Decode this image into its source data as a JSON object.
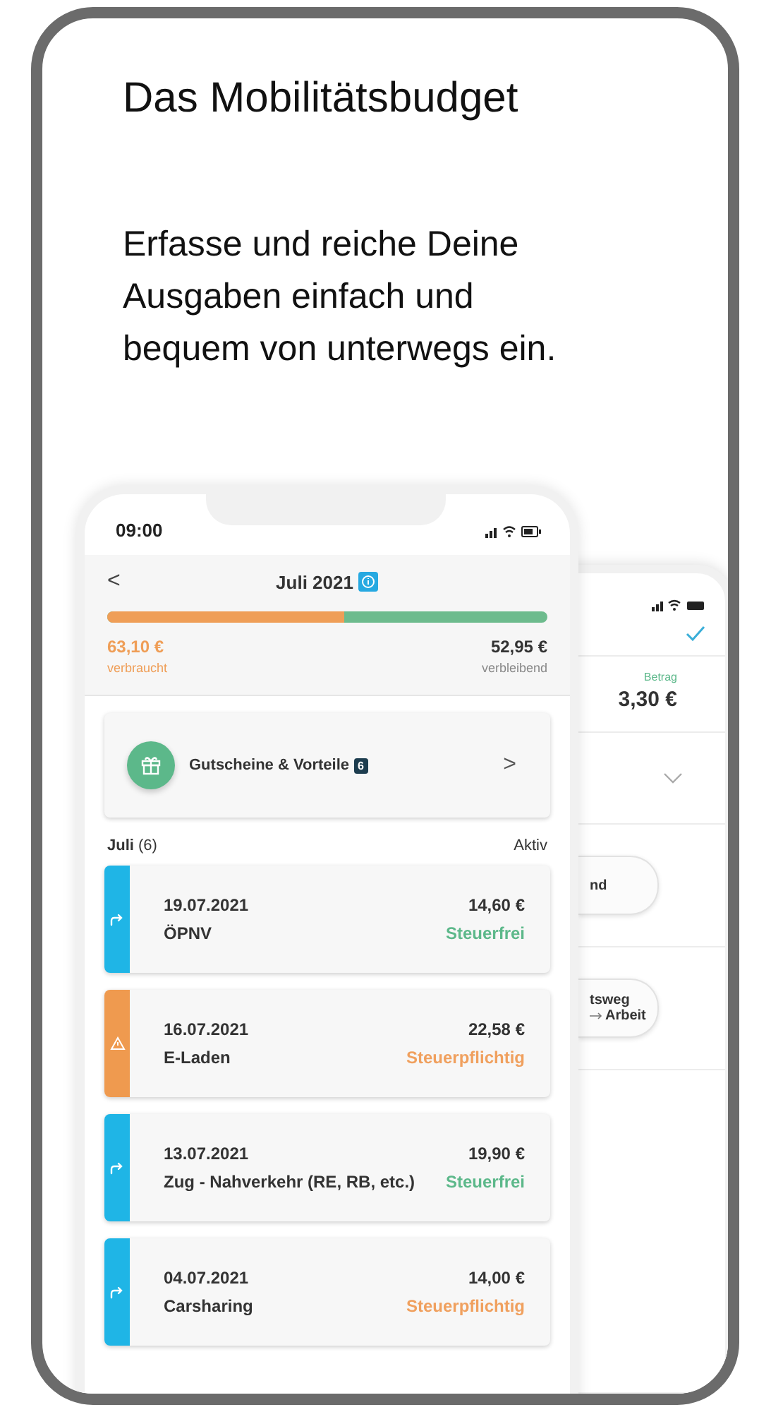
{
  "title": "Das Mobilitätsbudget",
  "subtitle": "Erfasse und reiche Deine Ausgaben einfach und bequem von unterwegs ein.",
  "phone": {
    "time": "09:00",
    "header": {
      "back": "<",
      "title": "Juli 2021"
    },
    "budget": {
      "level": 0.54,
      "spent": "63,10 €",
      "spent_label": "verbraucht",
      "remaining": "52,95 €",
      "remaining_label": "verbleibend"
    },
    "voucher": {
      "label": "Gutscheine & Vorteile",
      "badge": "6",
      "chevron": ">"
    },
    "list_header": {
      "month": "Juli",
      "count": "(6)",
      "filter": "Aktiv"
    },
    "entries": [
      {
        "date": "19.07.2021",
        "name": "ÖPNV",
        "amount": "14,60 €",
        "status": {
          "text": "Steuerfrei",
          "color": "#5cb88a"
        },
        "kind": "transfer",
        "color": "#1fb5e6"
      },
      {
        "date": "16.07.2021",
        "name": "E-Laden",
        "amount": "22,58 €",
        "status": {
          "text": "Steuerpflichtig",
          "color": "#f0a05e"
        },
        "kind": "warning",
        "color": "#ef9a4f"
      },
      {
        "date": "13.07.2021",
        "name": "Zug - Nahverkehr (RE, RB, etc.)",
        "amount": "19,90 €",
        "status": {
          "text": "Steuerfrei",
          "color": "#5cb88a"
        },
        "kind": "transfer",
        "color": "#1fb5e6"
      },
      {
        "date": "04.07.2021",
        "name": "Carsharing",
        "amount": "14,00 €",
        "status": {
          "text": "Steuerpflichtig",
          "color": "#f0a05e"
        },
        "kind": "transfer",
        "color": "#1fb5e6"
      }
    ]
  },
  "back_phone": {
    "amount_label": "Betrag",
    "amount": "3,30 €",
    "option_1": "nd",
    "option_2": "tsweg",
    "option_2_sub": "Arbeit"
  }
}
